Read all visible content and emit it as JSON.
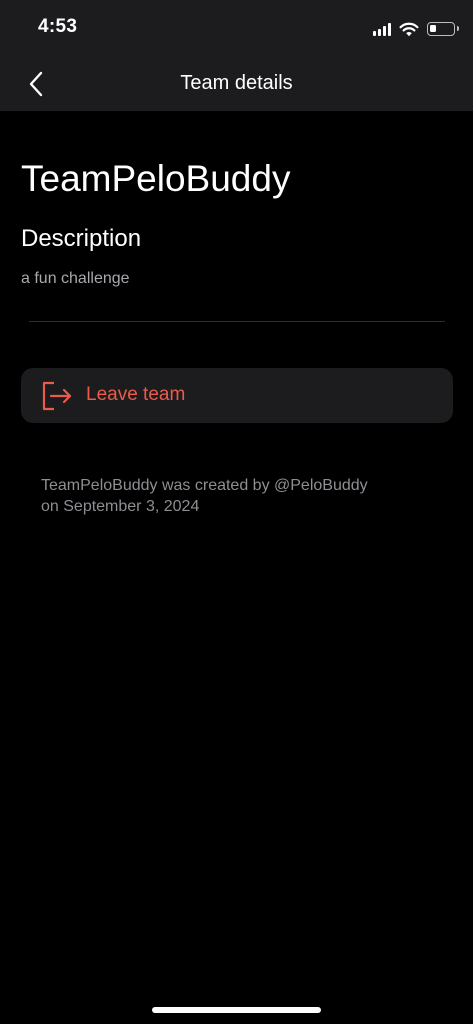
{
  "status_bar": {
    "time": "4:53",
    "icons": [
      "cellular-signal-icon",
      "wifi-icon",
      "battery-icon"
    ]
  },
  "nav": {
    "back_icon": "chevron-left-icon",
    "title": "Team details"
  },
  "team": {
    "name": "TeamPeloBuddy",
    "description_heading": "Description",
    "description": "a fun challenge"
  },
  "actions": {
    "leave_icon": "leave-door-icon",
    "leave_label": "Leave team"
  },
  "footer": {
    "created_line1": "TeamPeloBuddy was created by @PeloBuddy",
    "created_line2": "on September 3, 2024"
  },
  "colors": {
    "background": "#000000",
    "bar_background": "#1c1c1e",
    "destructive": "#eb5a4a",
    "secondary_text": "#a8a8ad"
  }
}
